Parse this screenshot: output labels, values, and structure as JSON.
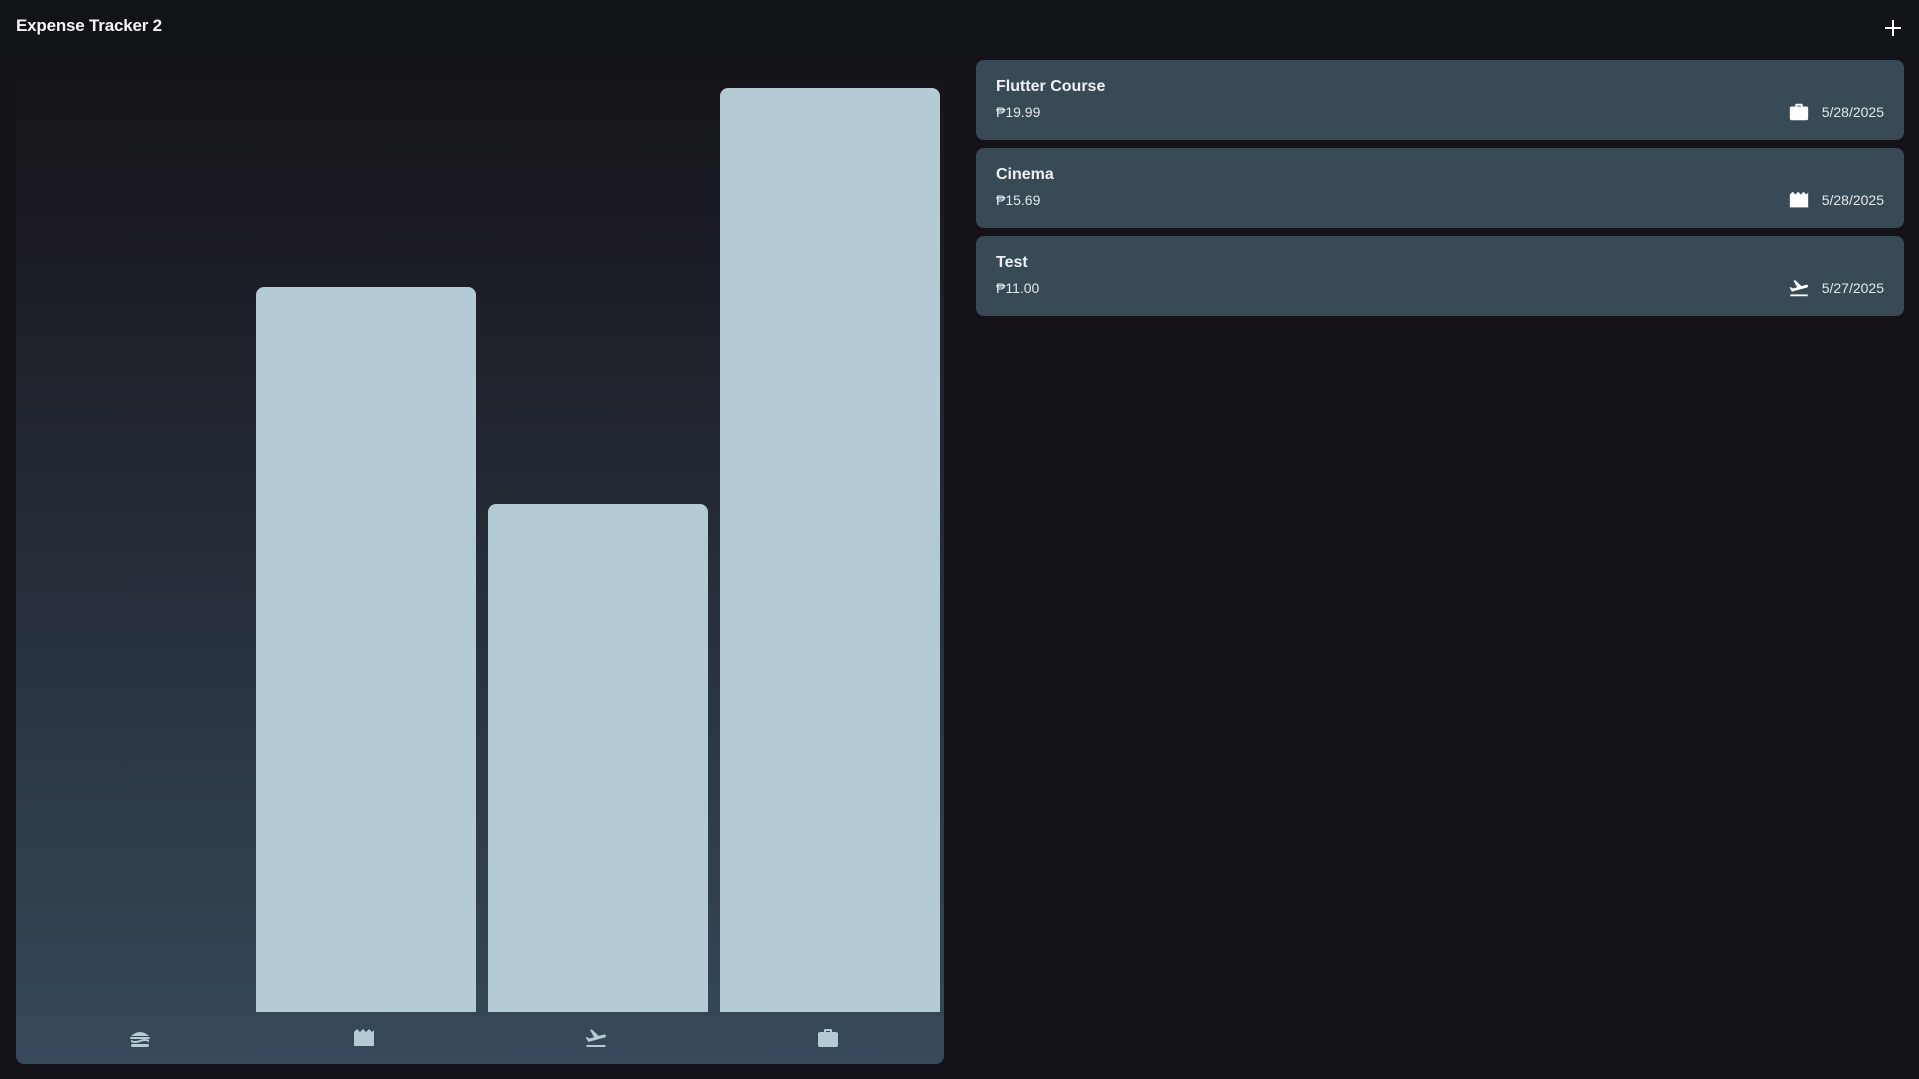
{
  "app": {
    "title": "Expense Tracker 2",
    "add_icon": "plus-icon"
  },
  "chart_data": {
    "type": "bar",
    "categories": [
      "food",
      "leisure",
      "travel",
      "work"
    ],
    "category_icons": [
      "lunch-icon",
      "movie-icon",
      "flight-takeoff-icon",
      "briefcase-icon"
    ],
    "values": [
      0,
      15.69,
      11.0,
      19.99
    ],
    "ylim": [
      0,
      19.99
    ],
    "bar_color": "#b4cad4",
    "gradient_colors": [
      "#141218",
      "#37495a"
    ]
  },
  "expenses": [
    {
      "title": "Flutter Course",
      "amount": "₱19.99",
      "date": "5/28/2025",
      "icon": "briefcase-icon"
    },
    {
      "title": "Cinema",
      "amount": "₱15.69",
      "date": "5/28/2025",
      "icon": "movie-icon"
    },
    {
      "title": "Test",
      "amount": "₱11.00",
      "date": "5/27/2025",
      "icon": "flight-takeoff-icon"
    }
  ],
  "colors": {
    "background": "#141218",
    "appbar": "#111417",
    "card": "#374a56",
    "text": "#eef1f3"
  }
}
